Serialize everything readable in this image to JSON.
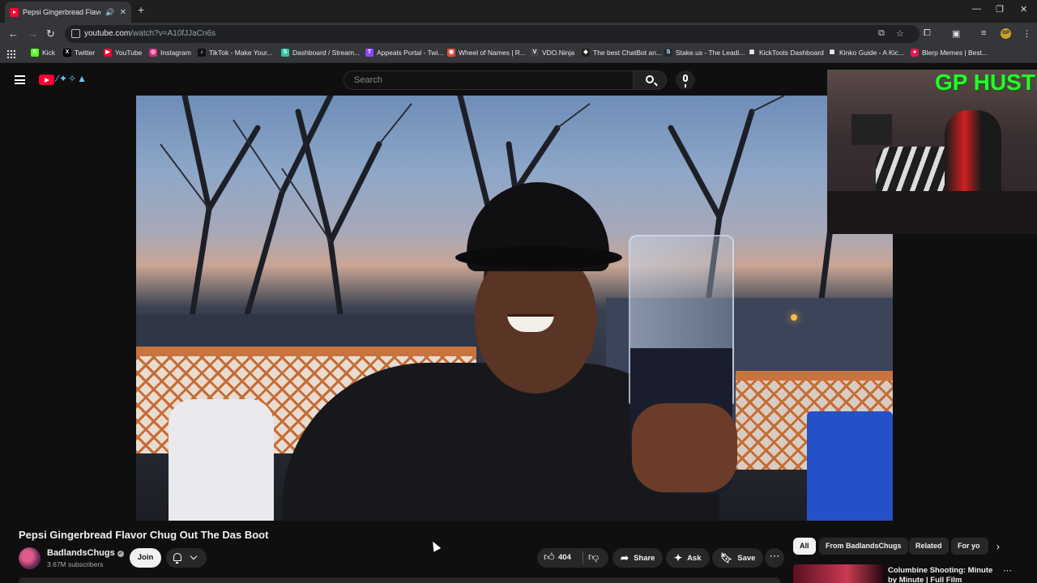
{
  "browser": {
    "tab_title": "Pepsi Gingerbread Flavor C",
    "url_host": "youtube.com",
    "url_path": "/watch?v=A10fJJaCn6s",
    "bookmarks": [
      {
        "label": "Kick",
        "icon": "kick-icon",
        "color": "#53fc18",
        "glyph": "K"
      },
      {
        "label": "Twitter",
        "icon": "x-icon",
        "color": "#000000",
        "glyph": "X"
      },
      {
        "label": "YouTube",
        "icon": "youtube-icon",
        "color": "#ff0033",
        "glyph": "▶"
      },
      {
        "label": "Instagram",
        "icon": "instagram-icon",
        "color": "#d6297a",
        "glyph": "◎"
      },
      {
        "label": "TikTok - Make Your...",
        "icon": "tiktok-icon",
        "color": "#111111",
        "glyph": "♪"
      },
      {
        "label": "Dashboard / Stream...",
        "icon": "streamlabs-icon",
        "color": "#31c3a2",
        "glyph": "S"
      },
      {
        "label": "Appeals Portal - Twi...",
        "icon": "twitch-icon",
        "color": "#9146ff",
        "glyph": "T"
      },
      {
        "label": "Wheel of Names | R...",
        "icon": "wheel-icon",
        "color": "#e04a3a",
        "glyph": "◉"
      },
      {
        "label": "VDO.Ninja",
        "icon": "vdo-ninja-icon",
        "color": "#444444",
        "glyph": "V"
      },
      {
        "label": "The best ChatBot an...",
        "icon": "chatbot-icon",
        "color": "#222222",
        "glyph": "◆"
      },
      {
        "label": "Stake.us - The Leadi...",
        "icon": "stake-icon",
        "color": "#1a2c38",
        "glyph": "S"
      },
      {
        "label": "KickTools Dashboard",
        "icon": "kicktools-icon",
        "color": "#333333",
        "glyph": "▦"
      },
      {
        "label": "Kinko Guide - A Kic...",
        "icon": "kinko-icon",
        "color": "#333333",
        "glyph": "▦"
      },
      {
        "label": "Blerp Memes | Best...",
        "icon": "blerp-icon",
        "color": "#e3174d",
        "glyph": "●"
      }
    ]
  },
  "youtube": {
    "search_placeholder": "Search",
    "video": {
      "title": "Pepsi Gingerbread Flavor Chug Out The Das Boot",
      "channel": "BadlandsChugs",
      "subscribers": "3.67M subscribers",
      "join_label": "Join",
      "likes": "404",
      "share_label": "Share",
      "ask_label": "Ask",
      "save_label": "Save"
    },
    "chips": [
      "All",
      "From BadlandsChugs",
      "Related",
      "For yo"
    ],
    "recommendation": {
      "title": "Columbine Shooting: Minute by Minute | Full Film"
    }
  },
  "overlay": {
    "cam_text": "GP HUSTLA"
  },
  "colors": {
    "accent": "#ff0033",
    "overlay_text": "#22ff2a",
    "background": "#0f0f0f"
  }
}
